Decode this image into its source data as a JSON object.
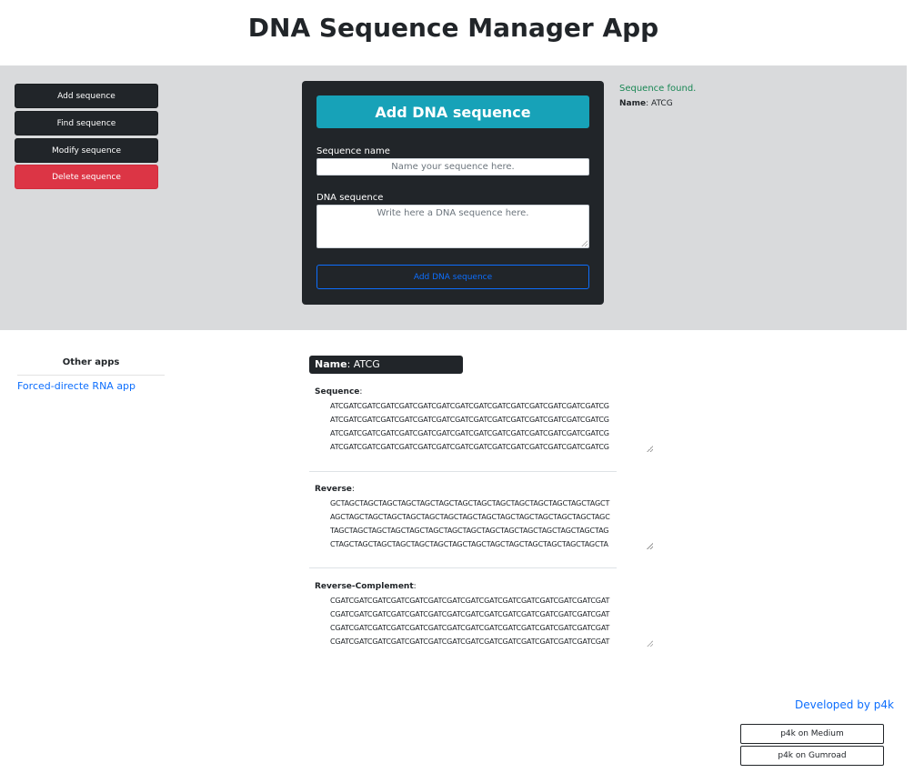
{
  "app": {
    "title": "DNA Sequence Manager App"
  },
  "sidebar": {
    "items": [
      {
        "label": "Add sequence"
      },
      {
        "label": "Find sequence"
      },
      {
        "label": "Modify sequence"
      },
      {
        "label": "Delete sequence"
      }
    ]
  },
  "form": {
    "header": "Add DNA sequence",
    "name_label": "Sequence name",
    "name_placeholder": "Name your sequence here.",
    "dna_label": "DNA sequence",
    "dna_placeholder": "Write here a DNA sequence here.",
    "submit_label": "Add DNA sequence"
  },
  "status": {
    "message": "Sequence found.",
    "name_key": "Name",
    "name_value": ": ATCG"
  },
  "other_apps": {
    "title": "Other apps",
    "links": [
      {
        "label": "Forced-directe RNA app"
      }
    ]
  },
  "result": {
    "name_key": "Name",
    "name_value": ": ATCG",
    "sections": [
      {
        "label": "Sequence",
        "suffix": ":",
        "text": "ATCGATCGATCGATCGATCGATCGATCGATCGATCGATCGATCGATCGATCGATCGATCG\nATCGATCGATCGATCGATCGATCGATCGATCGATCGATCGATCGATCGATCGATCGATCG\nATCGATCGATCGATCGATCGATCGATCGATCGATCGATCGATCGATCGATCGATCGATCG\nATCGATCGATCGATCGATCGATCGATCGATCGATCGATCGATCGATCGATCGATCGATCG"
      },
      {
        "label": "Reverse",
        "suffix": ":",
        "text": "GCTAGCTAGCTAGCTAGCTAGCTAGCTAGCTAGCTAGCTAGCTAGCTAGCTAGCTAGCT\nAGCTAGCTAGCTAGCTAGCTAGCTAGCTAGCTAGCTAGCTAGCTAGCTAGCTAGCTAGC\nTAGCTAGCTAGCTAGCTAGCTAGCTAGCTAGCTAGCTAGCTAGCTAGCTAGCTAGCTAG\nCTAGCTAGCTAGCTAGCTAGCTAGCTAGCTAGCTAGCTAGCTAGCTAGCTAGCTAGCTA"
      },
      {
        "label": "Reverse-Complement",
        "suffix": ":",
        "text": "CGATCGATCGATCGATCGATCGATCGATCGATCGATCGATCGATCGATCGATCGATCGAT\nCGATCGATCGATCGATCGATCGATCGATCGATCGATCGATCGATCGATCGATCGATCGAT\nCGATCGATCGATCGATCGATCGATCGATCGATCGATCGATCGATCGATCGATCGATCGAT\nCGATCGATCGATCGATCGATCGATCGATCGATCGATCGATCGATCGATCGATCGATCGAT"
      }
    ]
  },
  "footer": {
    "developer_link": "Developed by p4k",
    "buttons": [
      {
        "label": "p4k on Medium"
      },
      {
        "label": "p4k on Gumroad"
      }
    ]
  }
}
